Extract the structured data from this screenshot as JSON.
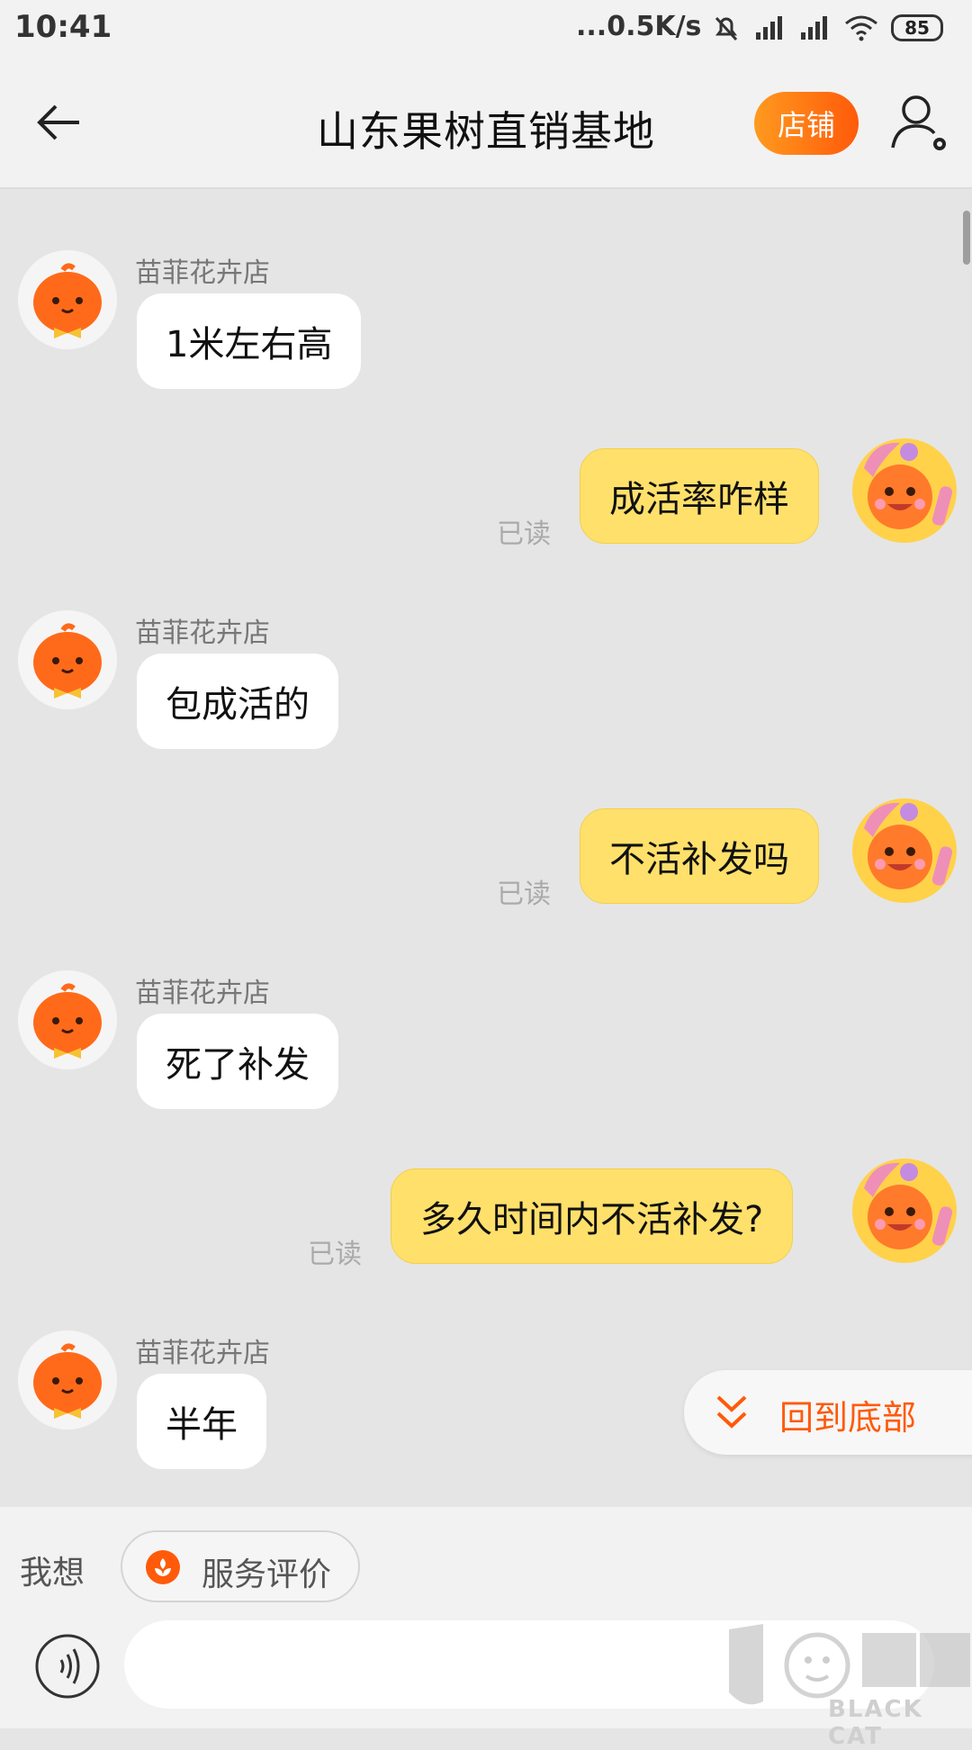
{
  "status_bar": {
    "time": "10:41",
    "speed": "...0.5K/s",
    "battery": "85"
  },
  "header": {
    "title": "山东果树直销基地",
    "shop_button": "店铺"
  },
  "messages": [
    {
      "side": "left",
      "sender": "苗菲花卉店",
      "text": "1米左右高"
    },
    {
      "side": "right",
      "text": "成活率咋样",
      "status": "已读"
    },
    {
      "side": "left",
      "sender": "苗菲花卉店",
      "text": "包成活的"
    },
    {
      "side": "right",
      "text": "不活补发吗",
      "status": "已读"
    },
    {
      "side": "left",
      "sender": "苗菲花卉店",
      "text": "死了补发"
    },
    {
      "side": "right",
      "text": "多久时间内不活补发?",
      "status": "已读"
    },
    {
      "side": "left",
      "sender": "苗菲花卉店",
      "text": "半年"
    }
  ],
  "back_to_bottom": "回到底部",
  "footer": {
    "want_label": "我想",
    "service_chip": "服务评价",
    "input_placeholder": ""
  },
  "watermark": {
    "text": "BLACK CAT"
  },
  "colors": {
    "accent": "#ff5a0a",
    "user_bubble": "#ffe06b",
    "background": "#e5e5e5"
  },
  "icons": [
    "back-arrow-icon",
    "profile-settings-icon",
    "double-chevron-down-icon",
    "voice-icon",
    "service-flower-icon",
    "black-cat-watermark"
  ]
}
